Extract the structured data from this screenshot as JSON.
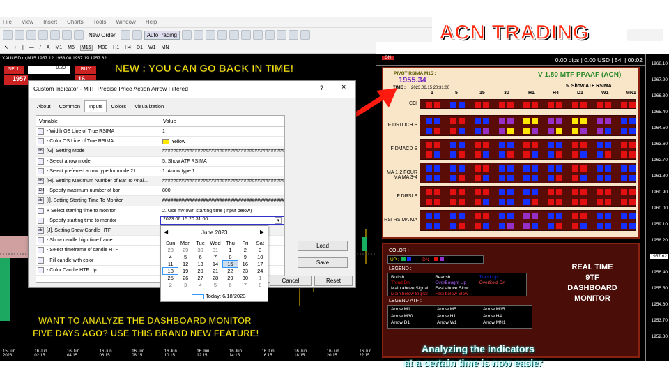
{
  "menu": [
    "File",
    "View",
    "Insert",
    "Charts",
    "Tools",
    "Window",
    "Help"
  ],
  "toolbar": {
    "new_order": "New Order",
    "autotrading": "AutoTrading"
  },
  "timeframes": [
    "M1",
    "M5",
    "M15",
    "M30",
    "H1",
    "H4",
    "D1",
    "W1",
    "MN"
  ],
  "active_tf": "M15",
  "symbol_line": "XAUUSD.m,M15  1957.12 1958.08 1957.19 1957.62",
  "trade": {
    "sell": "SELL",
    "buy": "BUY",
    "lot": "0.20",
    "sell_price": "1957",
    "buy_price": "16"
  },
  "headline": "ACN TRADING",
  "new_banner": "NEW : YOU CAN GO BACK IN TIME!",
  "bottom_banner": [
    "WANT TO ANALYZE THE DASHBOARD MONITOR",
    "FIVE DAYS AGO? USE THIS BRAND NEW FEATURE!"
  ],
  "bottom_right_banner": [
    "Analyzing the indicators",
    "at a certain time is now easier"
  ],
  "status_top": "0.00 pips | 0.00 USD | 54. | 00:02",
  "on_label": "ON",
  "dialog": {
    "title": "Custom Indicator - MTF Precise Price Action Arrow Filtered",
    "help": "?",
    "close": "×",
    "tabs": [
      "About",
      "Common",
      "Inputs",
      "Colors",
      "Visualization"
    ],
    "selected_tab": "Inputs",
    "col_variable": "Variable",
    "col_value": "Value",
    "rows": [
      {
        "icon": "arrow",
        "name": "- Width OS Line of True RSIMA",
        "value": "1"
      },
      {
        "icon": "arrow",
        "name": "- Color OS Line of True RSIMA",
        "value": "Yellow",
        "swatch": "#ffe800"
      },
      {
        "icon": "ab",
        "name": "[G]. Setting Mode",
        "value": "################################################"
      },
      {
        "icon": "arrow",
        "name": "- Select arrow mode",
        "value": "5. Show ATF RSIMA"
      },
      {
        "icon": "arrow",
        "name": "- Select preferred arrow type for mode 21",
        "value": "1. Arrow type 1"
      },
      {
        "icon": "ab",
        "name": "[H]. Setting Maximum Number of Bar To Anal...",
        "value": "################################################"
      },
      {
        "icon": "123",
        "name": "- Specify maximum number of bar",
        "value": "800"
      },
      {
        "icon": "ab",
        "name": "[I]. Setting Starting Time To Monitor",
        "value": "################################################"
      },
      {
        "icon": "arrow",
        "name": "+ Select starting time to monitor",
        "value": "2. Use my own starting time (input below)"
      },
      {
        "icon": "cal",
        "name": "- Specify starting time to monitor",
        "value": "2023.06.15 20:31:00"
      },
      {
        "icon": "ab",
        "name": "[J]. Setting Show Candle HTF",
        "value": "##"
      },
      {
        "icon": "arrow",
        "name": "- Show candle high time frame",
        "value": ""
      },
      {
        "icon": "arrow",
        "name": "- Select timeframe of candle HTF",
        "value": ""
      },
      {
        "icon": "arrow",
        "name": "- Fill candle with color",
        "value": ""
      },
      {
        "icon": "arrow",
        "name": "- Color Candle HTF Up",
        "value": ""
      }
    ],
    "buttons": {
      "load": "Load",
      "save": "Save",
      "ok": "OK",
      "cancel": "Cancel",
      "reset": "Reset"
    }
  },
  "calendar": {
    "month": "June 2023",
    "days": [
      "Sun",
      "Mon",
      "Tue",
      "Wed",
      "Thu",
      "Fri",
      "Sat"
    ],
    "dates": [
      [
        "28",
        "29",
        "30",
        "31",
        "1",
        "2",
        "3"
      ],
      [
        "4",
        "5",
        "6",
        "7",
        "8",
        "9",
        "10"
      ],
      [
        "11",
        "12",
        "13",
        "14",
        "15",
        "16",
        "17"
      ],
      [
        "18",
        "19",
        "20",
        "21",
        "22",
        "23",
        "24"
      ],
      [
        "25",
        "26",
        "27",
        "28",
        "29",
        "30",
        "1"
      ],
      [
        "2",
        "3",
        "4",
        "5",
        "6",
        "7",
        "8"
      ]
    ],
    "selected": "15",
    "today_cell": "18",
    "today": "Today: 6/18/2023"
  },
  "dashboard": {
    "pivot_label": "PIVOT RSIMA M15 :",
    "pivot_value": "1955.34",
    "time_label": "TIME :",
    "time_value": "2023.06.15 20:31:00",
    "version": "V 1.80 MTF PPAAF (ACN)",
    "mode": "5. Show ATF RSIMA",
    "columns": [
      "1",
      "5",
      "15",
      "30",
      "H1",
      "H4",
      "D1",
      "W1",
      "MN1"
    ],
    "rows": [
      {
        "label": "CCI",
        "cells": "r,b,r,r,r,r,r,r,r"
      },
      {
        "label": "F DSTOCH S",
        "cells": "b,r,b,p,y,p,y,p,b"
      },
      {
        "label": "F DMACD S",
        "cells": "r,b,r,b,r,b,r,b,r"
      },
      {
        "label": "MA 1-2 FOUR MA MA 3-4",
        "cells": "b,b,r,b,b,b,r,b,b"
      },
      {
        "label": "F DRSI S",
        "cells": "r,r,r,b,b,r,r,r,r"
      },
      {
        "label": "RSI RSIMA MA",
        "cells": "b,b,r,b,p,b,r,b,b"
      }
    ]
  },
  "legend": {
    "color": "COLOR :",
    "up": "UP :",
    "dn": "DN :",
    "legend_title": "LEGEND :",
    "items": [
      "Bullish",
      "Bearish",
      "Trend Up",
      "Trend Dn",
      "OverBought Up",
      "OverSold Dn",
      "Main above Signal",
      "Fast above Slow",
      "Main below Signal",
      "Fast below Slow"
    ],
    "atf_title": "LEGEND ATF :",
    "atf_items": [
      "Arrow M1",
      "Arrow M5",
      "Arrow M15",
      "Arrow M30",
      "Arrow H1",
      "Arrow H4",
      "Arrow D1",
      "Arrow W1",
      "Arrow MN1"
    ]
  },
  "realtime": [
    "REAL TIME",
    "9TF",
    "DASHBOARD",
    "MONITOR"
  ],
  "prices": [
    "1968.10",
    "1967.20",
    "1966.30",
    "1965.40",
    "1964.50",
    "1963.60",
    "1962.70",
    "1961.80",
    "1960.90",
    "1960.00",
    "1959.10",
    "1958.20",
    "1957.62",
    "1956.40",
    "1955.50",
    "1954.60",
    "1953.70",
    "1952.80"
  ],
  "times": [
    "15 Jun 2023",
    "16 Jun 02:15",
    "16 Jun 04:15",
    "16 Jun 06:15",
    "16 Jun 08:15",
    "16 Jun 10:15",
    "16 Jun 12:15",
    "16 Jun 14:15",
    "16 Jun 16:15",
    "16 Jun 18:15",
    "16 Jun 20:15",
    "16 Jun 22:15"
  ],
  "colors": {
    "accent": "#e21010",
    "banner": "#ffea00",
    "dash_bg": "#f9e6c8"
  }
}
